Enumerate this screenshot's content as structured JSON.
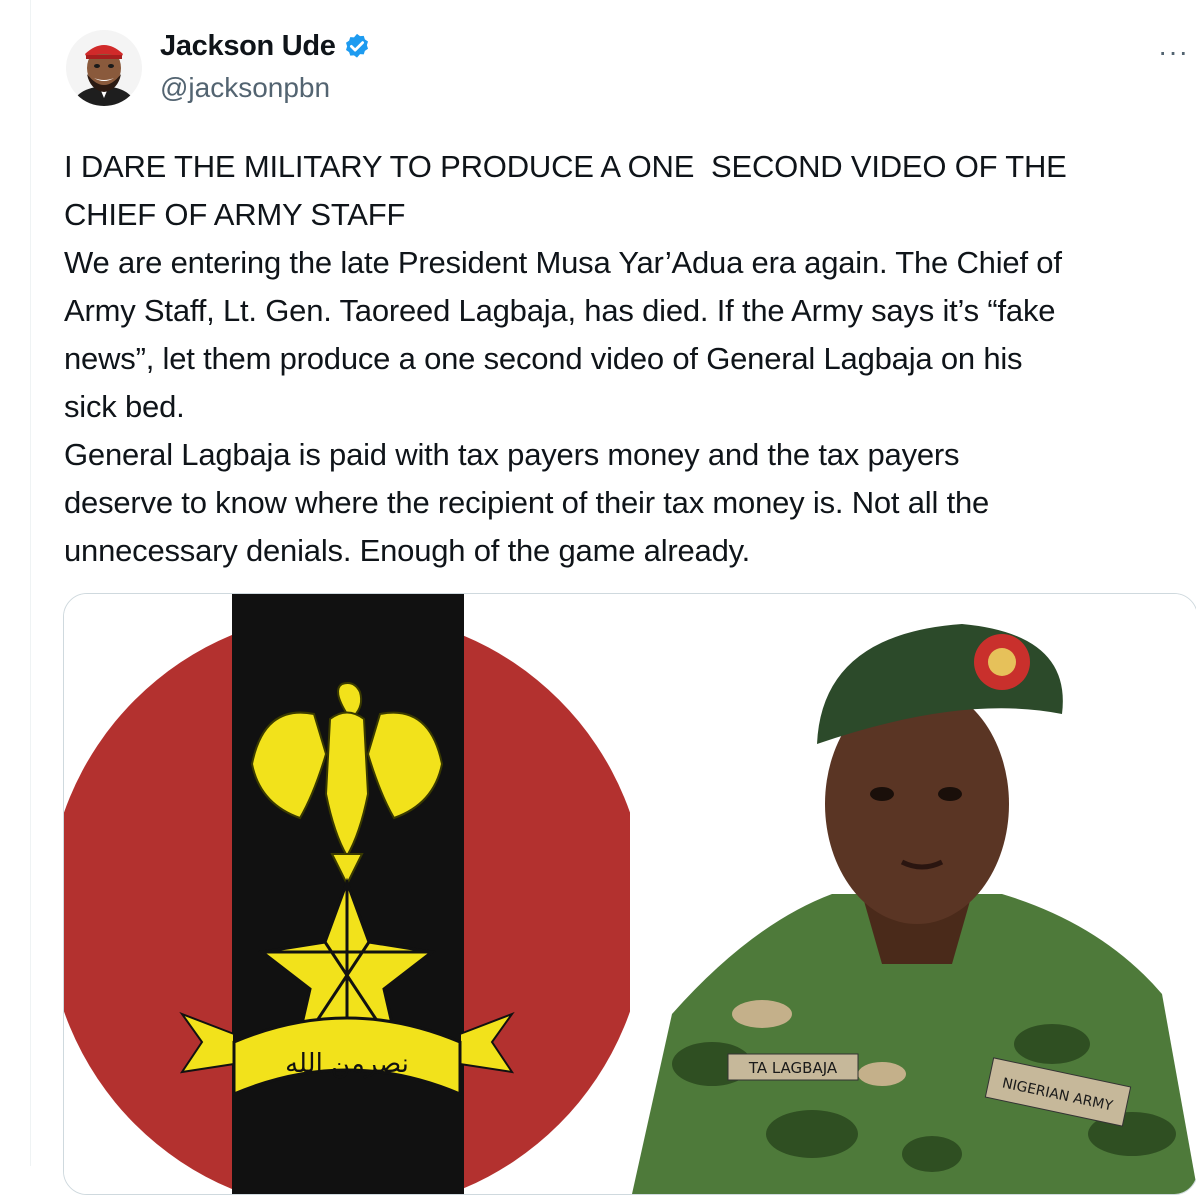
{
  "author": {
    "display_name": "Jackson Ude",
    "handle": "@jacksonpbn",
    "verified": true,
    "avatar_icon": "cartoon-man-red-cap-avatar"
  },
  "more_menu_label": "···",
  "tweet": {
    "text": "I DARE THE MILITARY TO PRODUCE A ONE  SECOND VIDEO OF THE\nCHIEF OF ARMY STAFF\nWe are entering the late President Musa Yar’Adua era again. The Chief of\nArmy Staff, Lt. Gen. Taoreed Lagbaja, has died. If the Army says it’s “fake\nnews”, let them produce a one second video of General Lagbaja on his\nsick bed.\nGeneral Lagbaja is paid with tax payers money and the tax payers\ndeserve to know where the recipient of their tax money is. Not all the\nunnecessary denials. Enough of the game already."
  },
  "media": {
    "left_image": "nigerian-army-crest-logo",
    "left_inscription": "نصرمن الله",
    "right_image": "officer-portrait-in-camouflage-uniform",
    "name_tape": "TA LAGBAJA",
    "shoulder_patch": "NIGERIAN ARMY"
  },
  "colors": {
    "crest_red": "#b3312f",
    "crest_black": "#111111",
    "crest_gold": "#f2e21b",
    "verified_blue": "#1d9bf0",
    "camo_green": "#4e7a3a"
  }
}
